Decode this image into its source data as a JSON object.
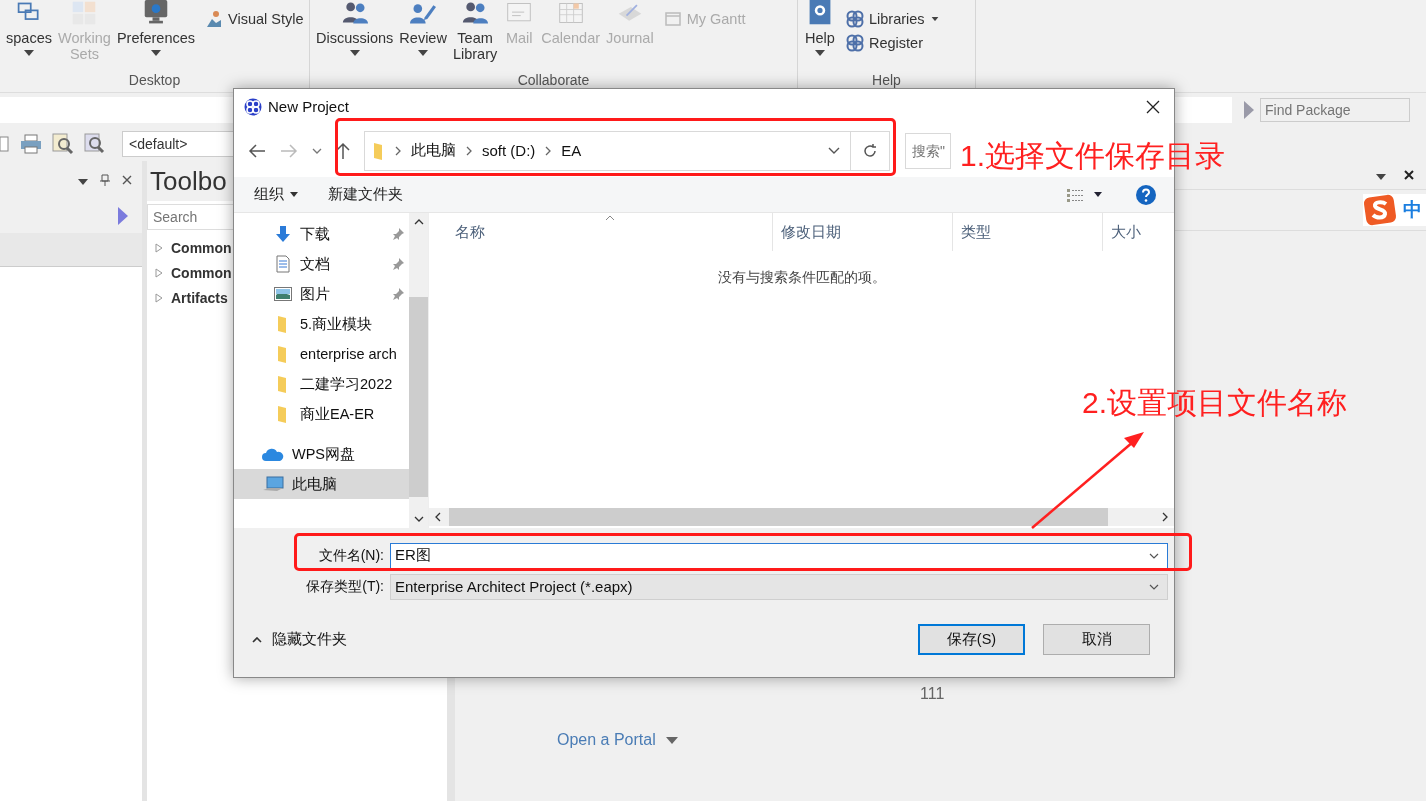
{
  "ribbon": {
    "groups": [
      {
        "label": "Desktop",
        "items": [
          {
            "kind": "large",
            "label": "spaces",
            "disabled": false,
            "menu": true
          },
          {
            "kind": "large",
            "label": "Working Sets",
            "disabled": true,
            "menu": false
          },
          {
            "kind": "large",
            "label": "Preferences",
            "disabled": false,
            "menu": true
          },
          {
            "kind": "small",
            "label": "Visual Style",
            "disabled": false,
            "menu": false
          }
        ]
      },
      {
        "label": "Collaborate",
        "items": [
          {
            "kind": "large",
            "label": "Discussions",
            "disabled": false,
            "menu": true
          },
          {
            "kind": "large",
            "label": "Review",
            "disabled": false,
            "menu": true
          },
          {
            "kind": "large",
            "label": "Team Library",
            "disabled": false,
            "menu": false
          },
          {
            "kind": "large",
            "label": "Mail",
            "disabled": true,
            "menu": false
          },
          {
            "kind": "large",
            "label": "Calendar",
            "disabled": true,
            "menu": false
          },
          {
            "kind": "large",
            "label": "Journal",
            "disabled": true,
            "menu": false
          },
          {
            "kind": "small",
            "label": "My Gantt",
            "disabled": true,
            "menu": false
          }
        ]
      },
      {
        "label": "Help",
        "items": [
          {
            "kind": "large",
            "label": "Help",
            "disabled": false,
            "menu": true
          },
          {
            "kind": "small",
            "label": "Libraries",
            "disabled": false,
            "menu": true
          },
          {
            "kind": "small",
            "label": "Register",
            "disabled": false,
            "menu": false
          }
        ]
      }
    ]
  },
  "find_package": {
    "placeholder": "Find Package"
  },
  "toolbar": {
    "view_select": "<default>"
  },
  "toolbox": {
    "title": "Toolbo",
    "search": {
      "placeholder": "Search"
    },
    "items": [
      "Common",
      "Common",
      "Artifacts"
    ]
  },
  "start_page": {
    "count": "111",
    "portal_link": "Open a Portal"
  },
  "ime_badge": "中",
  "dialog": {
    "title": "New Project",
    "breadcrumb": [
      "此电脑",
      "soft (D:)",
      "EA"
    ],
    "search": {
      "placeholder": "搜索\""
    },
    "commands": {
      "organize": "组织",
      "new_folder": "新建文件夹"
    },
    "nav_items": [
      {
        "kind": "download",
        "label": "下载",
        "pinned": true,
        "selected": false
      },
      {
        "kind": "document",
        "label": "文档",
        "pinned": true,
        "selected": false
      },
      {
        "kind": "picture",
        "label": "图片",
        "pinned": true,
        "selected": false
      },
      {
        "kind": "folder",
        "label": "5.商业模块",
        "pinned": false,
        "selected": false
      },
      {
        "kind": "folder",
        "label": "enterprise arch",
        "pinned": false,
        "selected": false
      },
      {
        "kind": "folder",
        "label": "二建学习2022",
        "pinned": false,
        "selected": false
      },
      {
        "kind": "folder",
        "label": "商业EA-ER",
        "pinned": false,
        "selected": false
      },
      {
        "kind": "cloud",
        "label": "WPS网盘",
        "pinned": false,
        "selected": false
      },
      {
        "kind": "computer",
        "label": "此电脑",
        "pinned": false,
        "selected": true
      }
    ],
    "columns": [
      {
        "label": "名称",
        "sorted": true
      },
      {
        "label": "修改日期",
        "sorted": false
      },
      {
        "label": "类型",
        "sorted": false
      },
      {
        "label": "大小",
        "sorted": false
      }
    ],
    "empty_message": "没有与搜索条件匹配的项。",
    "file_name": {
      "label": "文件名(N):",
      "value": "ER图"
    },
    "file_type": {
      "label": "保存类型(T):",
      "value": "Enterprise Architect Project (*.eapx)"
    },
    "hide_folders": "隐藏文件夹",
    "buttons": [
      {
        "label": "保存(S)",
        "default": true
      },
      {
        "label": "取消",
        "default": false
      }
    ]
  },
  "annotations": [
    {
      "text": "1.选择文件保存目录"
    },
    {
      "text": "2.设置项目文件名称"
    }
  ]
}
